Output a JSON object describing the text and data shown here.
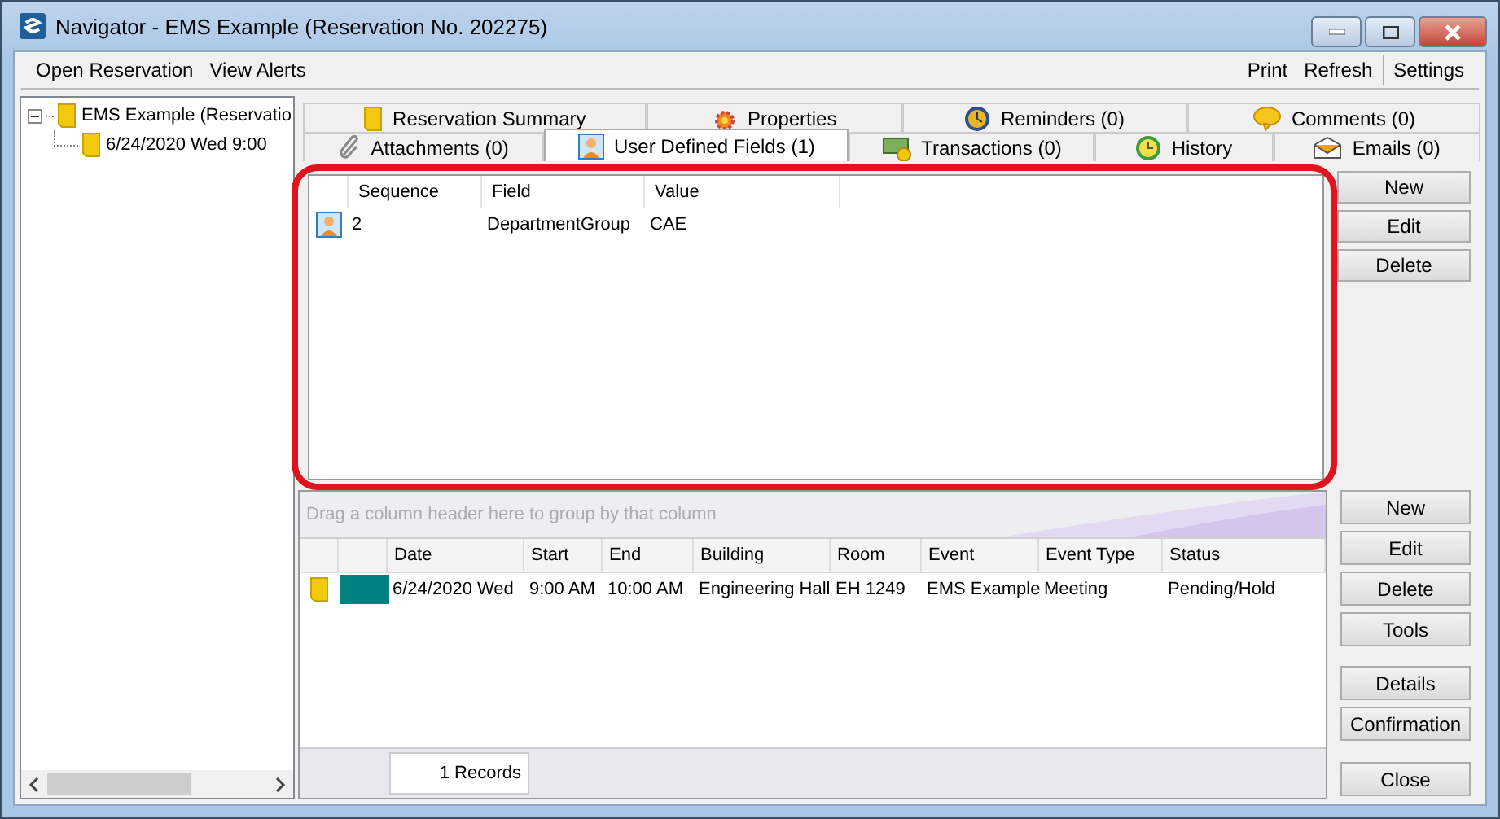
{
  "window": {
    "title": "Navigator - EMS Example (Reservation No. 202275)"
  },
  "menu": {
    "left": [
      "Open Reservation",
      "View Alerts"
    ],
    "right": [
      "Print",
      "Refresh",
      "Settings"
    ]
  },
  "tree": [
    {
      "label": "EMS Example (Reservatio",
      "expanded": true,
      "children": [
        {
          "label": "6/24/2020 Wed 9:00"
        }
      ]
    }
  ],
  "tab_rows": [
    {
      "tabs": [
        {
          "label": "Reservation Summary",
          "selected": false
        },
        {
          "label": "Properties",
          "selected": false
        },
        {
          "label": "Reminders (0)",
          "selected": false
        },
        {
          "label": "Comments (0)",
          "selected": false
        }
      ]
    },
    {
      "tabs": [
        {
          "label": "Attachments (0)",
          "selected": false
        },
        {
          "label": "User Defined Fields (1)",
          "selected": true
        },
        {
          "label": "Transactions (0)",
          "selected": false
        },
        {
          "label": "History",
          "selected": false
        },
        {
          "label": "Emails (0)",
          "selected": false
        }
      ]
    }
  ],
  "udf_grid": {
    "columns": [
      "Sequence",
      "Field",
      "Value"
    ],
    "rows": [
      {
        "cells": [
          "2",
          "DepartmentGroup",
          "CAE"
        ]
      }
    ]
  },
  "udf_buttons": [
    "New",
    "Edit",
    "Delete"
  ],
  "bookings": {
    "group_hint": "Drag a column header here to group by that column",
    "columns": [
      "Date",
      "Start",
      "End",
      "Building",
      "Room",
      "Event",
      "Event Type",
      "Status"
    ],
    "rows": [
      {
        "color": "#008080",
        "cells": [
          "6/24/2020 Wed",
          "9:00 AM",
          "10:00 AM",
          "Engineering Hall",
          "EH 1249",
          "EMS Example",
          "Meeting",
          "Pending/Hold"
        ]
      }
    ],
    "record_count": "1 Records"
  },
  "booking_buttons": [
    [
      "New",
      "Edit",
      "Delete",
      "Tools"
    ],
    [
      "Details",
      "Confirmation"
    ],
    [
      "Close"
    ]
  ]
}
